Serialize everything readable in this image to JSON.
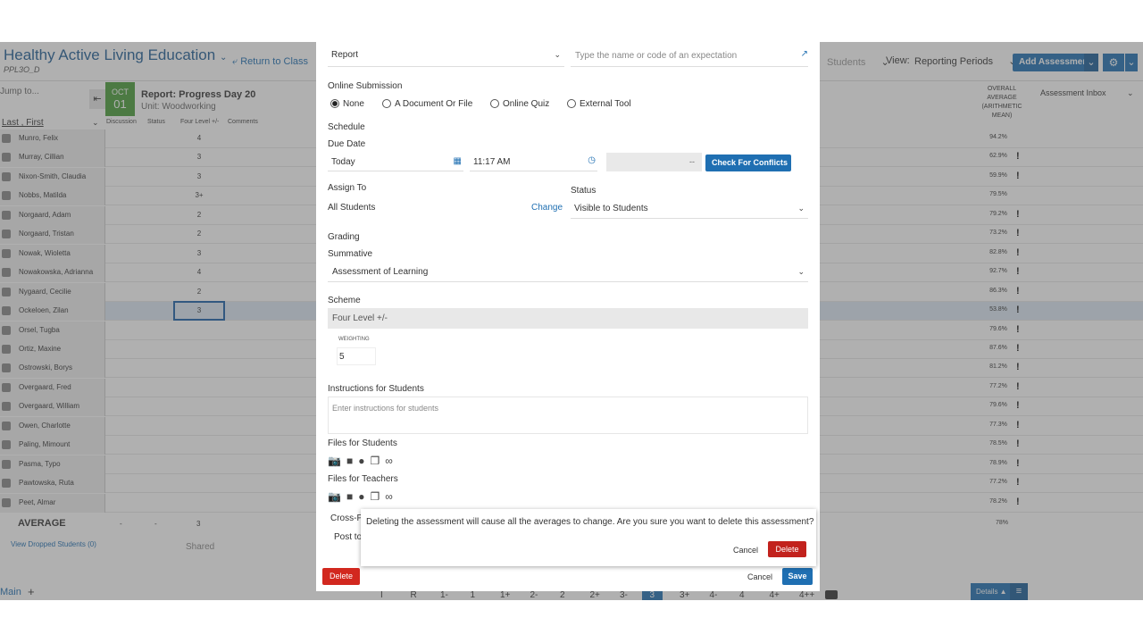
{
  "course": {
    "title": "Healthy Active Living Education",
    "code": "PPL3O_D",
    "return_label": "Return to Class"
  },
  "toolbar": {
    "students_view": "Students",
    "view_label": "View:",
    "view_value": "Reporting Periods",
    "add_assessment": "Add Assessment"
  },
  "sidebar": {
    "jump": "Jump to...",
    "sort": "Last , First"
  },
  "assessment": {
    "month": "OCT",
    "day": "01",
    "report": "Report: Progress Day 20",
    "unit": "Unit: Woodworking"
  },
  "columns": {
    "discussion": "Discussion",
    "status": "Status",
    "scheme": "Four Level +/-",
    "comments": "Comments"
  },
  "overall_header": "OVERALL AVERAGE (ARITHMETIC MEAN)",
  "inbox": "Assessment Inbox",
  "students": [
    {
      "name": "Munro, Felix",
      "grade": "4",
      "overall": "94.2%",
      "flag": ""
    },
    {
      "name": "Murray, Cillian",
      "grade": "3",
      "overall": "62.9%",
      "flag": "!"
    },
    {
      "name": "Nixon-Smith, Claudia",
      "grade": "3",
      "overall": "59.9%",
      "flag": "!"
    },
    {
      "name": "Nobbs, Matilda",
      "grade": "3+",
      "overall": "79.5%",
      "flag": ""
    },
    {
      "name": "Norgaard, Adam",
      "grade": "2",
      "overall": "79.2%",
      "flag": "!"
    },
    {
      "name": "Norgaard, Tristan",
      "grade": "2",
      "overall": "73.2%",
      "flag": "!"
    },
    {
      "name": "Nowak, Wioletta",
      "grade": "3",
      "overall": "82.8%",
      "flag": "!"
    },
    {
      "name": "Nowakowska, Adrianna",
      "grade": "4",
      "overall": "92.7%",
      "flag": "!"
    },
    {
      "name": "Nygaard, Cecilie",
      "grade": "2",
      "overall": "86.3%",
      "flag": "!"
    },
    {
      "name": "Ockeloen, Zilan",
      "grade": "3",
      "overall": "53.8%",
      "flag": "!"
    },
    {
      "name": "Orsel, Tugba",
      "grade": "",
      "overall": "79.6%",
      "flag": "!"
    },
    {
      "name": "Ortiz, Maxine",
      "grade": "",
      "overall": "87.6%",
      "flag": "!"
    },
    {
      "name": "Ostrowski, Borys",
      "grade": "",
      "overall": "81.2%",
      "flag": "!"
    },
    {
      "name": "Overgaard, Fred",
      "grade": "",
      "overall": "77.2%",
      "flag": "!"
    },
    {
      "name": "Overgaard, William",
      "grade": "",
      "overall": "79.6%",
      "flag": "!"
    },
    {
      "name": "Owen, Charlotte",
      "grade": "",
      "overall": "77.3%",
      "flag": "!"
    },
    {
      "name": "Paling, Mimount",
      "grade": "",
      "overall": "78.5%",
      "flag": "!"
    },
    {
      "name": "Pasma, Typo",
      "grade": "",
      "overall": "78.9%",
      "flag": "!"
    },
    {
      "name": "Pawtowska, Ruta",
      "grade": "",
      "overall": "77.2%",
      "flag": "!"
    },
    {
      "name": "Peet, Almar",
      "grade": "",
      "overall": "78.2%",
      "flag": "!"
    }
  ],
  "average": {
    "label": "AVERAGE",
    "discussion": "-",
    "status": "-",
    "grade": "3",
    "overall": "78%"
  },
  "dropped": "View Dropped Students (0)",
  "shared": "Shared",
  "bottom": {
    "main_tab": "Main",
    "plus": "+",
    "levels": [
      "I",
      "R",
      "1-",
      "1",
      "1+",
      "2-",
      "2",
      "2+",
      "3-",
      "3",
      "3+",
      "4-",
      "4",
      "4+",
      "4++"
    ],
    "selected_level": "3",
    "details": "Details ▲"
  },
  "modal": {
    "report_select": "Report",
    "expectation_placeholder": "Type the name or code of an expectation",
    "online_submission_label": "Online Submission",
    "submission_options": [
      "None",
      "A Document Or File",
      "Online Quiz",
      "External Tool"
    ],
    "schedule_label": "Schedule",
    "due_date_label": "Due Date",
    "due_date": "Today",
    "due_time": "11:17 AM",
    "end_time": "--",
    "check_conflicts": "Check For Conflicts",
    "assign_to_label": "Assign To",
    "assign_to": "All Students",
    "change": "Change",
    "status_label": "Status",
    "status_value": "Visible to Students",
    "grading_label": "Grading",
    "summative_label": "Summative",
    "summative_value": "Assessment of Learning",
    "scheme_label": "Scheme",
    "scheme_value": "Four Level +/-",
    "weighting_label": "WEIGHTING",
    "weighting_value": "5",
    "instructions_label": "Instructions for Students",
    "instructions_placeholder": "Enter instructions for students",
    "files_students_label": "Files for Students",
    "files_teachers_label": "Files for Teachers",
    "cross_post_label": "Cross-P",
    "post_to_label": "Post to",
    "delete": "Delete",
    "cancel": "Cancel",
    "save": "Save"
  },
  "confirm": {
    "message": "Deleting the assessment will cause all the averages to change. Are you sure you want to delete this assessment?",
    "cancel": "Cancel",
    "delete": "Delete"
  },
  "colors": {
    "accent": "#1f6fb2",
    "danger": "#d2281f",
    "date_green": "#4a9d3a"
  },
  "icons": {
    "camera": "camera-icon",
    "video": "video-icon",
    "mic": "microphone-icon",
    "files": "files-icon",
    "link": "link-icon"
  }
}
